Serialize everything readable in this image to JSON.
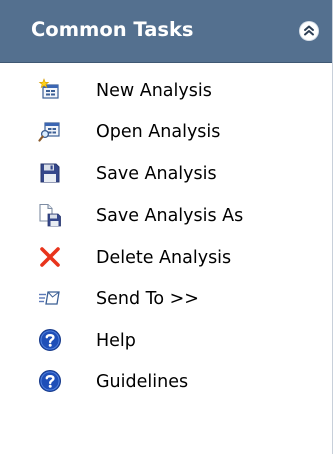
{
  "panel": {
    "title": "Common Tasks",
    "collapse_icon": "double-chevron-up-icon",
    "header_color": "#54708f"
  },
  "items": [
    {
      "label": "New Analysis",
      "icon": "new-analysis-icon"
    },
    {
      "label": "Open Analysis",
      "icon": "open-analysis-icon"
    },
    {
      "label": "Save Analysis",
      "icon": "save-icon"
    },
    {
      "label": "Save Analysis As",
      "icon": "save-as-icon"
    },
    {
      "label": "Delete Analysis",
      "icon": "delete-icon"
    },
    {
      "label": "Send To >>",
      "icon": "send-to-icon"
    },
    {
      "label": "Help",
      "icon": "help-icon"
    },
    {
      "label": "Guidelines",
      "icon": "guidelines-icon"
    }
  ],
  "colors": {
    "delete_red": "#e8341c",
    "help_blue": "#1f4fb8",
    "save_blue": "#35478a"
  }
}
